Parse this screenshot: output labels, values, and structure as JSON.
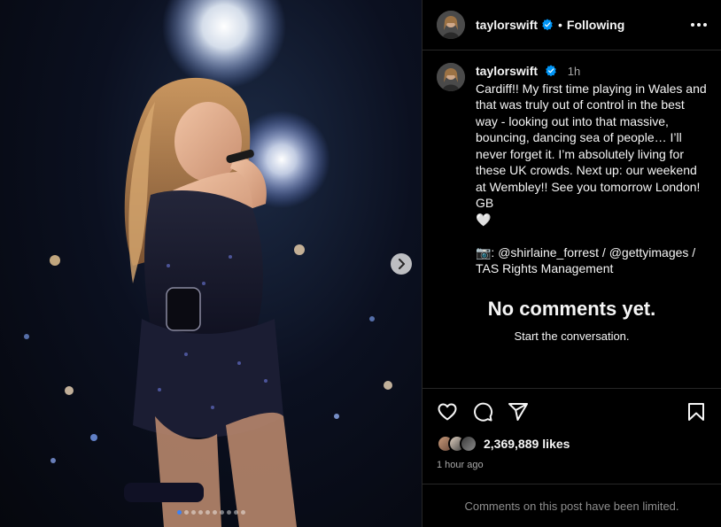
{
  "post": {
    "username": "taylorswift",
    "follow_status": "Following",
    "separator": "•",
    "time_ago": "1h",
    "caption": "Cardiff!! My first time playing in Wales and that was truly out of control in the best way - looking out into that massive, bouncing, dancing sea of people… I’ll never forget it. I’m absolutely living for these UK crowds. Next up: our weekend at Wembley!! See you tomorrow London! GB\n🤍\n\n📷: @shirlaine_forrest / @gettyimages / TAS Rights Management"
  },
  "comments": {
    "empty_title": "No comments yet.",
    "empty_subtitle": "Start the conversation."
  },
  "engagement": {
    "likes_count": "2,369,889",
    "likes_label": "likes",
    "posted_time": "1 hour ago",
    "limited_notice": "Comments on this post have been limited."
  },
  "carousel": {
    "total_slides": 10,
    "active_index": 0
  },
  "colors": {
    "verified_blue": "#0095f6",
    "background": "#000000",
    "divider": "#262626",
    "muted_text": "#a8a8a8"
  },
  "icons": {
    "header": [
      "verified-badge-icon",
      "more-options-icon"
    ],
    "actions": [
      "heart-icon",
      "comment-icon",
      "share-icon",
      "bookmark-icon"
    ],
    "media": [
      "chevron-right-icon"
    ]
  }
}
